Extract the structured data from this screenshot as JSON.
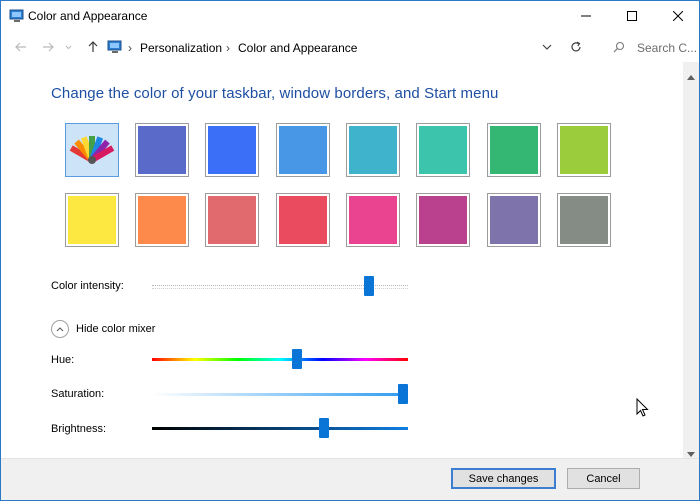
{
  "window": {
    "title": "Color and Appearance"
  },
  "address": {
    "breadcrumb": [
      "Personalization",
      "Color and Appearance"
    ],
    "search_placeholder": "Search C..."
  },
  "main": {
    "heading": "Change the color of your taskbar, window borders, and Start menu",
    "swatches": [
      "#ffffff",
      "#5a6ac9",
      "#3c6ff7",
      "#4896e6",
      "#3fb3cc",
      "#3dc4ad",
      "#35b774",
      "#9bcc3b",
      "#fde841",
      "#fd8a4b",
      "#e06a6e",
      "#ea4b5e",
      "#ea4390",
      "#b9418e",
      "#7f73ab",
      "#858c85"
    ],
    "selected_swatch_icon": "color-palette-icon",
    "color_intensity_label": "Color intensity:",
    "color_intensity_value": 0.86,
    "mixer_toggle_label": "Hide color mixer",
    "hue_label": "Hue:",
    "hue_value": 0.57,
    "saturation_label": "Saturation:",
    "saturation_value": 1.0,
    "brightness_label": "Brightness:",
    "brightness_value": 0.68
  },
  "footer": {
    "save_label": "Save changes",
    "cancel_label": "Cancel"
  },
  "colors": {
    "accent": "#0a74d7",
    "heading": "#1e4fa2",
    "selected_swatch_bg": "#cde3f7"
  }
}
